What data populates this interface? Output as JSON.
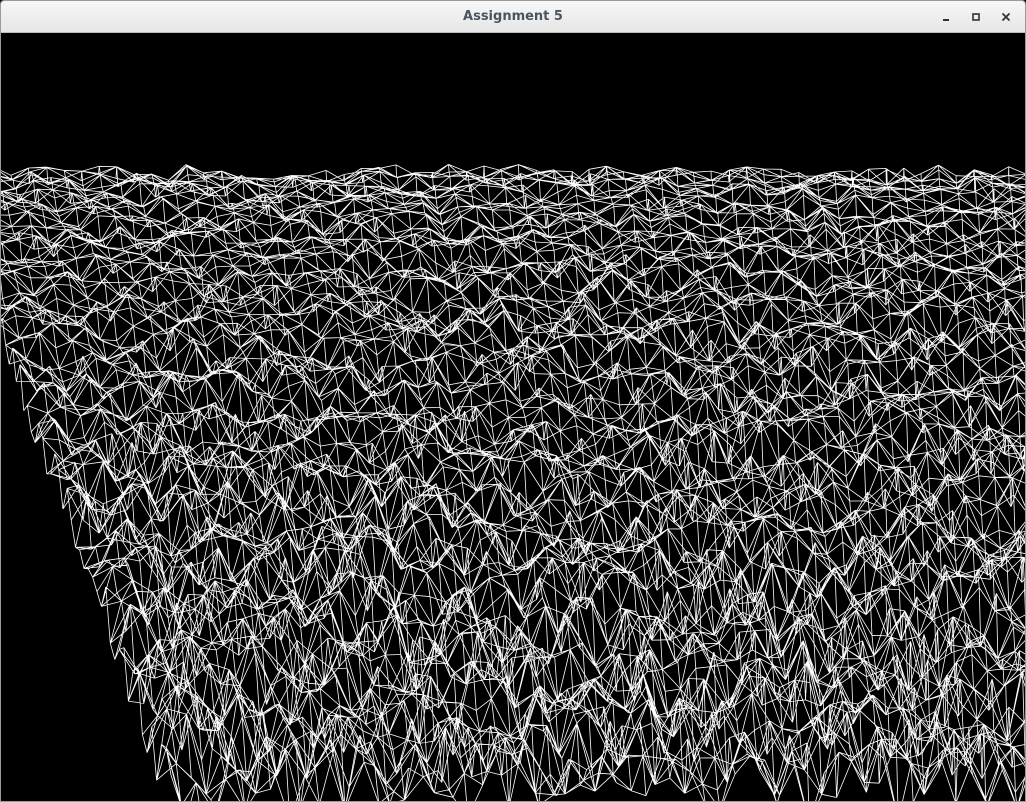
{
  "window": {
    "title": "Assignment 5",
    "icons": {
      "minimize": "minimize-icon",
      "maximize": "maximize-icon",
      "close": "close-icon"
    }
  },
  "viewport": {
    "content": "wireframe-terrain-mesh",
    "background_color": "#000000",
    "line_color": "#ffffff"
  }
}
